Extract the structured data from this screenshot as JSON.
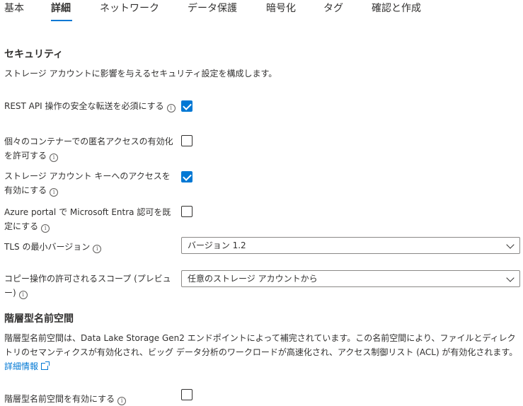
{
  "tabs": [
    "基本",
    "詳細",
    "ネットワーク",
    "データ保護",
    "暗号化",
    "タグ",
    "確認と作成"
  ],
  "active_tab": "詳細",
  "security": {
    "heading": "セキュリティ",
    "description": "ストレージ アカウントに影響を与えるセキュリティ設定を構成します。",
    "secure_transfer": {
      "label": "REST API 操作の安全な転送を必須にする",
      "checked": true
    },
    "anonymous_access": {
      "label": "個々のコンテナーでの匿名アクセスの有効化を許可する",
      "checked": false
    },
    "key_access": {
      "label": "ストレージ アカウント キーへのアクセスを有効にする",
      "checked": true
    },
    "entra_default": {
      "label": "Azure portal で Microsoft Entra 認可を既定にする",
      "checked": false
    },
    "tls": {
      "label": "TLS の最小バージョン",
      "value": "バージョン 1.2"
    },
    "copy_scope": {
      "label": "コピー操作の許可されるスコープ (プレビュー)",
      "value": "任意のストレージ アカウントから"
    }
  },
  "hns": {
    "heading": "階層型名前空間",
    "description": "階層型名前空間は、Data Lake Storage Gen2 エンドポイントによって補完されています。この名前空間により、ファイルとディレクトリのセマンティクスが有効化され、ビッグ データ分析のワークロードが高速化され、アクセス制御リスト (ACL) が有効化されます。",
    "learn_more": "詳細情報",
    "enable": {
      "label": "階層型名前空間を有効にする",
      "checked": false
    }
  },
  "icons": {
    "info": "info-icon",
    "checkmark": "checkmark-icon",
    "dropdown": "chevron-down-icon",
    "external": "external-link-icon"
  },
  "colors": {
    "accent": "#0078d4",
    "text": "#323130"
  }
}
